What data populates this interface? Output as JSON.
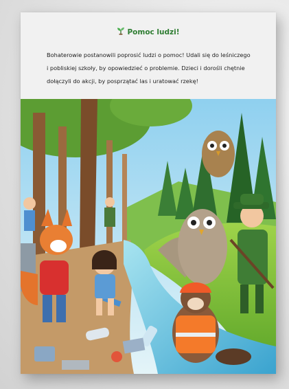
{
  "page": {
    "title_icon": "seedling-icon",
    "title": "Pomoc ludzi!",
    "paragraph_lines": [
      "Bohaterowie postanowili poprosić ludzi o pomoc! Udali się do leśniczego",
      "i pobliskiej szkoły, by opowiedzieć o problemie. Dzieci i dorośli chętnie",
      "dołączyli do akcji, by posprzątać las i uratować rzekę!"
    ]
  },
  "colors": {
    "title": "#2e7d32",
    "text": "#1c1c1c",
    "header_bg": "#f1f1f1"
  }
}
